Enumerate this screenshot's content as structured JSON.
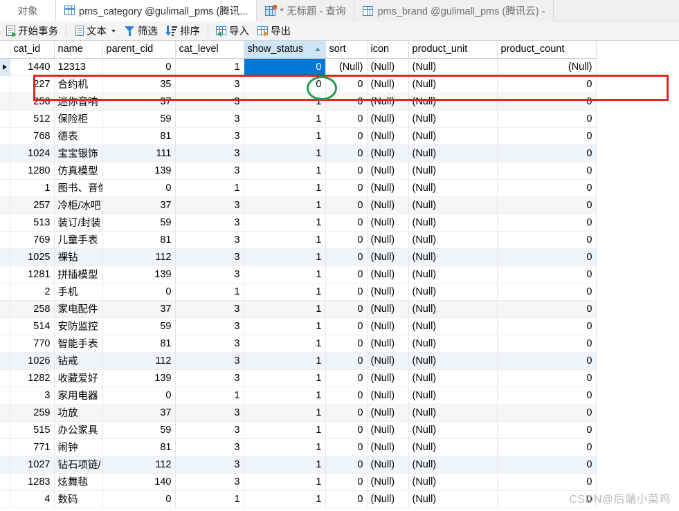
{
  "window": {
    "tabs": [
      {
        "label": "对象",
        "icon": "none",
        "state": "object-tab"
      },
      {
        "label": "pms_category @gulimall_pms (腾讯...",
        "icon": "grid-icon",
        "state": "active"
      },
      {
        "label": "* 无标题 - 查询",
        "icon": "grid-star-icon",
        "state": "inactive"
      },
      {
        "label": "pms_brand @gulimall_pms (腾讯云) -",
        "icon": "grid-icon",
        "state": "inactive"
      }
    ]
  },
  "toolbar": {
    "buttons": [
      {
        "label": "开始事务",
        "icon": "begin-transaction-icon",
        "dropdown": false
      },
      {
        "label": "文本",
        "icon": "text-icon",
        "dropdown": true
      },
      {
        "label": "筛选",
        "icon": "filter-icon",
        "dropdown": false
      },
      {
        "label": "排序",
        "icon": "sort-icon",
        "dropdown": false
      },
      {
        "label": "导入",
        "icon": "import-icon",
        "dropdown": false
      },
      {
        "label": "导出",
        "icon": "export-icon",
        "dropdown": false
      }
    ]
  },
  "grid": {
    "columns": [
      {
        "key": "cat_id",
        "label": "cat_id",
        "align": "num",
        "sorted": false
      },
      {
        "key": "name",
        "label": "name",
        "align": "txt",
        "sorted": false
      },
      {
        "key": "parent_cid",
        "label": "parent_cid",
        "align": "num",
        "sorted": false
      },
      {
        "key": "cat_level",
        "label": "cat_level",
        "align": "num",
        "sorted": false
      },
      {
        "key": "show_status",
        "label": "show_status",
        "align": "num",
        "sorted": true
      },
      {
        "key": "sort",
        "label": "sort",
        "align": "num",
        "sorted": false
      },
      {
        "key": "icon",
        "label": "icon",
        "align": "txt",
        "sorted": false
      },
      {
        "key": "product_unit",
        "label": "product_unit",
        "align": "txt",
        "sorted": false
      },
      {
        "key": "product_count",
        "label": "product_count",
        "align": "num",
        "sorted": false
      }
    ],
    "sort_indicator": "ascending",
    "null_text": "(Null)",
    "rows": [
      {
        "marker": true,
        "shade": "none",
        "selected_cell": "show_status",
        "cat_id": "1440",
        "name": "12313",
        "parent_cid": "0",
        "cat_level": "1",
        "show_status": "0",
        "sort": "(Null)",
        "icon": "(Null)",
        "product_unit": "(Null)",
        "product_count": "(Null)"
      },
      {
        "marker": false,
        "shade": "none",
        "selected_cell": "",
        "cat_id": "227",
        "name": "合约机",
        "parent_cid": "35",
        "cat_level": "3",
        "show_status": "0",
        "sort": "0",
        "icon": "(Null)",
        "product_unit": "(Null)",
        "product_count": "0"
      },
      {
        "marker": false,
        "shade": "gray",
        "selected_cell": "",
        "cat_id": "256",
        "name": "迷你音响",
        "parent_cid": "37",
        "cat_level": "3",
        "show_status": "1",
        "sort": "0",
        "icon": "(Null)",
        "product_unit": "(Null)",
        "product_count": "0"
      },
      {
        "marker": false,
        "shade": "none",
        "selected_cell": "",
        "cat_id": "512",
        "name": "保险柜",
        "parent_cid": "59",
        "cat_level": "3",
        "show_status": "1",
        "sort": "0",
        "icon": "(Null)",
        "product_unit": "(Null)",
        "product_count": "0"
      },
      {
        "marker": false,
        "shade": "none",
        "selected_cell": "",
        "cat_id": "768",
        "name": "德表",
        "parent_cid": "81",
        "cat_level": "3",
        "show_status": "1",
        "sort": "0",
        "icon": "(Null)",
        "product_unit": "(Null)",
        "product_count": "0"
      },
      {
        "marker": false,
        "shade": "blue",
        "selected_cell": "",
        "cat_id": "1024",
        "name": "宝宝银饰",
        "parent_cid": "111",
        "cat_level": "3",
        "show_status": "1",
        "sort": "0",
        "icon": "(Null)",
        "product_unit": "(Null)",
        "product_count": "0"
      },
      {
        "marker": false,
        "shade": "none",
        "selected_cell": "",
        "cat_id": "1280",
        "name": "仿真模型",
        "parent_cid": "139",
        "cat_level": "3",
        "show_status": "1",
        "sort": "0",
        "icon": "(Null)",
        "product_unit": "(Null)",
        "product_count": "0"
      },
      {
        "marker": false,
        "shade": "none",
        "selected_cell": "",
        "cat_id": "1",
        "name": "图书、音像",
        "parent_cid": "0",
        "cat_level": "1",
        "show_status": "1",
        "sort": "0",
        "icon": "(Null)",
        "product_unit": "(Null)",
        "product_count": "0"
      },
      {
        "marker": false,
        "shade": "gray",
        "selected_cell": "",
        "cat_id": "257",
        "name": "冷柜/冰吧",
        "parent_cid": "37",
        "cat_level": "3",
        "show_status": "1",
        "sort": "0",
        "icon": "(Null)",
        "product_unit": "(Null)",
        "product_count": "0"
      },
      {
        "marker": false,
        "shade": "none",
        "selected_cell": "",
        "cat_id": "513",
        "name": "装订/封装",
        "parent_cid": "59",
        "cat_level": "3",
        "show_status": "1",
        "sort": "0",
        "icon": "(Null)",
        "product_unit": "(Null)",
        "product_count": "0"
      },
      {
        "marker": false,
        "shade": "none",
        "selected_cell": "",
        "cat_id": "769",
        "name": "儿童手表",
        "parent_cid": "81",
        "cat_level": "3",
        "show_status": "1",
        "sort": "0",
        "icon": "(Null)",
        "product_unit": "(Null)",
        "product_count": "0"
      },
      {
        "marker": false,
        "shade": "blue",
        "selected_cell": "",
        "cat_id": "1025",
        "name": "裸钻",
        "parent_cid": "112",
        "cat_level": "3",
        "show_status": "1",
        "sort": "0",
        "icon": "(Null)",
        "product_unit": "(Null)",
        "product_count": "0"
      },
      {
        "marker": false,
        "shade": "none",
        "selected_cell": "",
        "cat_id": "1281",
        "name": "拼插模型",
        "parent_cid": "139",
        "cat_level": "3",
        "show_status": "1",
        "sort": "0",
        "icon": "(Null)",
        "product_unit": "(Null)",
        "product_count": "0"
      },
      {
        "marker": false,
        "shade": "none",
        "selected_cell": "",
        "cat_id": "2",
        "name": "手机",
        "parent_cid": "0",
        "cat_level": "1",
        "show_status": "1",
        "sort": "0",
        "icon": "(Null)",
        "product_unit": "(Null)",
        "product_count": "0"
      },
      {
        "marker": false,
        "shade": "gray",
        "selected_cell": "",
        "cat_id": "258",
        "name": "家电配件",
        "parent_cid": "37",
        "cat_level": "3",
        "show_status": "1",
        "sort": "0",
        "icon": "(Null)",
        "product_unit": "(Null)",
        "product_count": "0"
      },
      {
        "marker": false,
        "shade": "none",
        "selected_cell": "",
        "cat_id": "514",
        "name": "安防监控",
        "parent_cid": "59",
        "cat_level": "3",
        "show_status": "1",
        "sort": "0",
        "icon": "(Null)",
        "product_unit": "(Null)",
        "product_count": "0"
      },
      {
        "marker": false,
        "shade": "none",
        "selected_cell": "",
        "cat_id": "770",
        "name": "智能手表",
        "parent_cid": "81",
        "cat_level": "3",
        "show_status": "1",
        "sort": "0",
        "icon": "(Null)",
        "product_unit": "(Null)",
        "product_count": "0"
      },
      {
        "marker": false,
        "shade": "blue",
        "selected_cell": "",
        "cat_id": "1026",
        "name": "钻戒",
        "parent_cid": "112",
        "cat_level": "3",
        "show_status": "1",
        "sort": "0",
        "icon": "(Null)",
        "product_unit": "(Null)",
        "product_count": "0"
      },
      {
        "marker": false,
        "shade": "none",
        "selected_cell": "",
        "cat_id": "1282",
        "name": "收藏爱好",
        "parent_cid": "139",
        "cat_level": "3",
        "show_status": "1",
        "sort": "0",
        "icon": "(Null)",
        "product_unit": "(Null)",
        "product_count": "0"
      },
      {
        "marker": false,
        "shade": "none",
        "selected_cell": "",
        "cat_id": "3",
        "name": "家用电器",
        "parent_cid": "0",
        "cat_level": "1",
        "show_status": "1",
        "sort": "0",
        "icon": "(Null)",
        "product_unit": "(Null)",
        "product_count": "0"
      },
      {
        "marker": false,
        "shade": "gray",
        "selected_cell": "",
        "cat_id": "259",
        "name": "功放",
        "parent_cid": "37",
        "cat_level": "3",
        "show_status": "1",
        "sort": "0",
        "icon": "(Null)",
        "product_unit": "(Null)",
        "product_count": "0"
      },
      {
        "marker": false,
        "shade": "none",
        "selected_cell": "",
        "cat_id": "515",
        "name": "办公家具",
        "parent_cid": "59",
        "cat_level": "3",
        "show_status": "1",
        "sort": "0",
        "icon": "(Null)",
        "product_unit": "(Null)",
        "product_count": "0"
      },
      {
        "marker": false,
        "shade": "none",
        "selected_cell": "",
        "cat_id": "771",
        "name": "闹钟",
        "parent_cid": "81",
        "cat_level": "3",
        "show_status": "1",
        "sort": "0",
        "icon": "(Null)",
        "product_unit": "(Null)",
        "product_count": "0"
      },
      {
        "marker": false,
        "shade": "blue",
        "selected_cell": "",
        "cat_id": "1027",
        "name": "钻石项链/",
        "parent_cid": "112",
        "cat_level": "3",
        "show_status": "1",
        "sort": "0",
        "icon": "(Null)",
        "product_unit": "(Null)",
        "product_count": "0"
      },
      {
        "marker": false,
        "shade": "none",
        "selected_cell": "",
        "cat_id": "1283",
        "name": "炫舞毯",
        "parent_cid": "140",
        "cat_level": "3",
        "show_status": "1",
        "sort": "0",
        "icon": "(Null)",
        "product_unit": "(Null)",
        "product_count": "0"
      },
      {
        "marker": false,
        "shade": "none",
        "selected_cell": "",
        "cat_id": "4",
        "name": "数码",
        "parent_cid": "0",
        "cat_level": "1",
        "show_status": "1",
        "sort": "0",
        "icon": "(Null)",
        "product_unit": "(Null)",
        "product_count": "0"
      }
    ]
  },
  "annotations": {
    "highlight_rect_color": "#e8221f",
    "highlight_circle_color": "#1f9d4d",
    "watermark": "CSDN@后端小菜鸡"
  }
}
